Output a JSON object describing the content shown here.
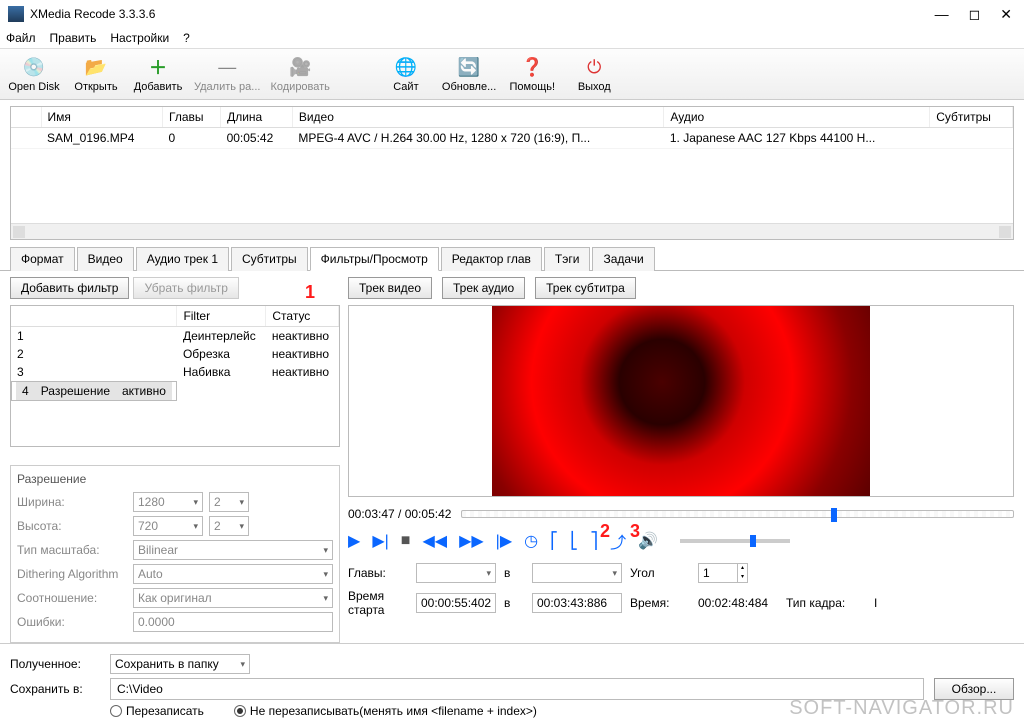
{
  "window": {
    "title": "XMedia Recode 3.3.3.6"
  },
  "menu": {
    "file": "Файл",
    "edit": "Править",
    "settings": "Настройки",
    "help": "?"
  },
  "toolbar": {
    "open_disk": "Open Disk",
    "open": "Открыть",
    "add": "Добавить",
    "remove": "Удалить ра...",
    "encode": "Кодировать",
    "site": "Сайт",
    "updates": "Обновле...",
    "help": "Помощь!",
    "exit": "Выход"
  },
  "file_table": {
    "headers": {
      "name": "Имя",
      "chapters": "Главы",
      "length": "Длина",
      "video": "Видео",
      "audio": "Аудио",
      "subs": "Субтитры"
    },
    "row": {
      "name": "SAM_0196.MP4",
      "chapters": "0",
      "length": "00:05:42",
      "video": "MPEG-4 AVC / H.264 30.00 Hz, 1280 x 720 (16:9), П...",
      "audio": "1. Japanese AAC  127 Kbps 44100 H..."
    }
  },
  "tabs": {
    "format": "Формат",
    "video": "Видео",
    "audio1": "Аудио трек 1",
    "subs": "Субтитры",
    "filters": "Фильтры/Просмотр",
    "chapters": "Редактор глав",
    "tags": "Тэги",
    "tasks": "Задачи"
  },
  "filter_btns": {
    "add": "Добавить фильтр",
    "remove": "Убрать фильтр"
  },
  "filter_table": {
    "headers": {
      "filter": "Filter",
      "status": "Статус"
    },
    "rows": [
      {
        "n": "1",
        "name": "Деинтерлейс",
        "status": "неактивно"
      },
      {
        "n": "2",
        "name": "Обрезка",
        "status": "неактивно"
      },
      {
        "n": "3",
        "name": "Набивка",
        "status": "неактивно"
      },
      {
        "n": "4",
        "name": "Разрешение",
        "status": "активно"
      }
    ]
  },
  "resolution": {
    "header": "Разрешение",
    "width_lbl": "Ширина:",
    "width": "1280",
    "width2": "2",
    "height_lbl": "Высота:",
    "height": "720",
    "height2": "2",
    "scale_lbl": "Тип масштаба:",
    "scale": "Bilinear",
    "dither_lbl": "Dithering Algorithm",
    "dither": "Auto",
    "ratio_lbl": "Соотношение:",
    "ratio": "Как оригинал",
    "errors_lbl": "Ошибки:",
    "errors": "0.0000"
  },
  "track_btns": {
    "video": "Трек видео",
    "audio": "Трек аудио",
    "sub": "Трек субтитра"
  },
  "player": {
    "time": "00:03:47 / 00:05:42",
    "chapters_lbl": "Главы:",
    "to": "в",
    "angle_lbl": "Угол",
    "angle": "1",
    "start_lbl": "Время старта",
    "start": "00:00:55:402",
    "end": "00:03:43:886",
    "dur_lbl": "Время:",
    "dur": "00:02:48:484",
    "frame_lbl": "Тип кадра:",
    "frame": "I"
  },
  "bottom": {
    "received_lbl": "Полученное:",
    "received": "Сохранить в папку",
    "saveto_lbl": "Сохранить в:",
    "saveto": "C:\\Video",
    "browse": "Обзор...",
    "overwrite": "Перезаписать",
    "no_overwrite": "Не перезаписывать(менять имя <filename + index>)"
  },
  "annotations": {
    "a1": "1",
    "a2": "2",
    "a3": "3"
  },
  "watermark": "SOFT-NAVIGATOR.RU"
}
